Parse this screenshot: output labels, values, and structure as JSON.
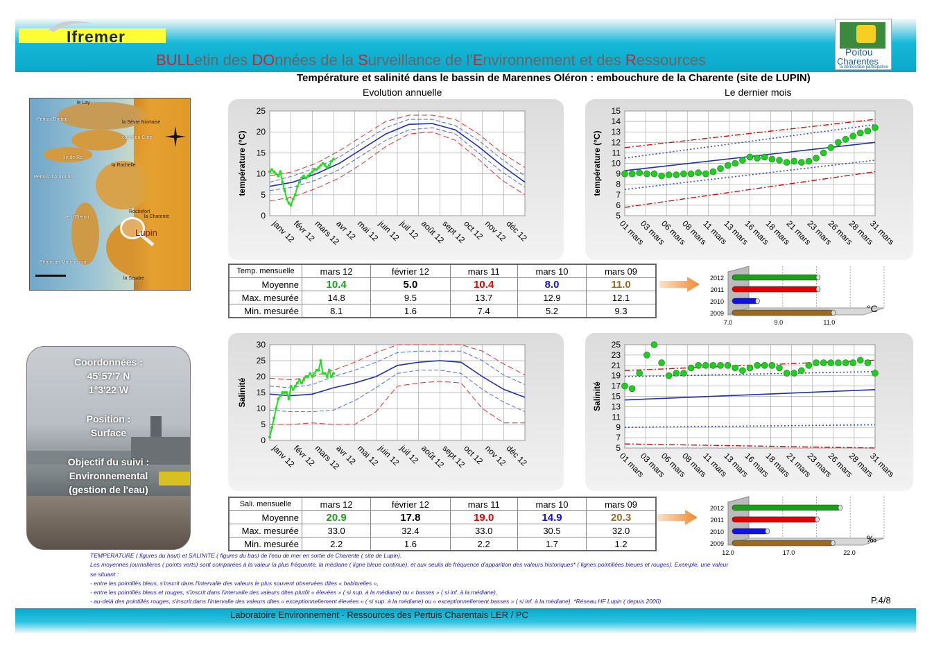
{
  "header": {
    "logo": "Ifremer",
    "bulletin_parts": [
      {
        "text": "BULL",
        "red": true
      },
      {
        "text": "etin des ",
        "red": false
      },
      {
        "text": "DO",
        "red": true
      },
      {
        "text": "nnées de la ",
        "red": false
      },
      {
        "text": "S",
        "red": true
      },
      {
        "text": "urveillance de l'",
        "red": false
      },
      {
        "text": "E",
        "red": true
      },
      {
        "text": "nvironnement et des ",
        "red": false
      },
      {
        "text": "R",
        "red": true
      },
      {
        "text": "essources",
        "red": false
      }
    ],
    "region_line1": "Poitou",
    "region_line2": "Charentes",
    "region_tag": "la démocratie participative",
    "region_vertical": "RÉGION"
  },
  "title": "Température et salinité dans le bassin de Marennes Oléron : embouchure de la Charente (site de LUPIN)",
  "subtitle_left": "Evolution annuelle",
  "subtitle_right": "Le dernier mois",
  "map": {
    "labels": [
      "le Lay",
      "Pertuis Breton",
      "la Sèvre Niortaise",
      "canal du Curé",
      "Ile de Ré",
      "la Rochelle",
      "Pertuis d'Antioche",
      "Rochefort",
      "la Charente",
      "Ile d'Oléron",
      "Lupin",
      "Peruis de Maumusson",
      "la Seudre"
    ]
  },
  "photo": {
    "coord_label": "Coordonnées :",
    "lat": "45°57'7 N",
    "lon": "1°3'22 W",
    "position_label": "Position :",
    "position_value": "Surface",
    "objectif_label": "Objectif du suivi :",
    "objectif_value": "Environnemental",
    "objectif_detail": "(gestion de l'eau)"
  },
  "colors": {
    "green": "#1aa01a",
    "red": "#e00000",
    "blue": "#1010e0",
    "brown": "#9a6a20",
    "navy": "#1f2fb0"
  },
  "chart_data": [
    {
      "type": "line",
      "ylabel": "température (°C)",
      "ylim": [
        0,
        25
      ],
      "yticks": [
        0,
        5,
        10,
        15,
        20,
        25
      ],
      "xticks": [
        "janv 12",
        "févr 12",
        "mars 12",
        "avr 12",
        "mai 12",
        "juin 12",
        "juil 12",
        "août 12",
        "sept 12",
        "oct 12",
        "nov 12",
        "déc 12"
      ],
      "x_months": [
        0,
        1,
        2,
        3,
        4,
        5,
        6,
        7,
        8,
        9,
        10,
        11,
        12
      ],
      "series": [
        {
          "style": "median",
          "values": [
            7,
            8,
            10,
            12.5,
            16,
            19.5,
            21.8,
            22,
            20.5,
            16.5,
            12,
            8
          ]
        },
        {
          "style": "blue_dash_high",
          "values": [
            8,
            9.5,
            11.5,
            14,
            17.5,
            21,
            23,
            23,
            21.5,
            18,
            13.5,
            9.5
          ]
        },
        {
          "style": "blue_dash_low",
          "values": [
            6,
            6.8,
            8.5,
            11,
            14.5,
            18,
            20.5,
            21,
            19.5,
            15,
            10.5,
            6.8
          ]
        },
        {
          "style": "red_dash_high",
          "values": [
            9.5,
            10.5,
            12.5,
            15.5,
            19,
            22.5,
            24,
            24,
            23,
            19.5,
            15,
            11.5
          ]
        },
        {
          "style": "red_dash_low",
          "values": [
            3.5,
            4.5,
            6.5,
            9,
            12.5,
            16.5,
            19.5,
            20,
            18,
            13.5,
            8.5,
            5
          ]
        },
        {
          "style": "green_obs",
          "x": [
            0,
            0.1,
            0.2,
            0.3,
            0.4,
            0.5,
            0.6,
            0.7,
            0.8,
            0.9,
            1.0,
            1.1,
            1.2,
            1.3,
            1.4,
            1.5,
            1.6,
            1.7,
            1.8,
            1.9,
            2.0,
            2.1,
            2.2,
            2.3,
            2.4,
            2.5,
            2.6,
            2.7,
            2.8,
            2.9,
            3.0
          ],
          "values": [
            10.5,
            11,
            10.5,
            10,
            9.5,
            10.5,
            8,
            6,
            4,
            3,
            2.5,
            4,
            5,
            7,
            8,
            9,
            9.5,
            9,
            9.5,
            10,
            10.5,
            11,
            11,
            11.5,
            12,
            12.5,
            12,
            11.5,
            12,
            13,
            13.5
          ]
        }
      ]
    },
    {
      "type": "scatter",
      "ylabel": "température (°C)",
      "ylim": [
        5,
        15
      ],
      "yticks": [
        5,
        6,
        7,
        8,
        9,
        10,
        11,
        12,
        13,
        14,
        15
      ],
      "xticks": [
        "01 mars",
        "03 mars",
        "06 mars",
        "08 mars",
        "11 mars",
        "13 mars",
        "16 mars",
        "18 mars",
        "21 mars",
        "23 mars",
        "26 mars",
        "28 mars",
        "31 mars"
      ],
      "days": 31,
      "lines": [
        {
          "style": "median",
          "from": 9.3,
          "to": 12
        },
        {
          "style": "blue_dot_high",
          "from": 10.5,
          "to": 13.7
        },
        {
          "style": "blue_dot_low",
          "from": 7.5,
          "to": 10.3
        },
        {
          "style": "red_dashdot_high",
          "from": 11.5,
          "to": 14.2
        },
        {
          "style": "red_dashdot_low",
          "from": 5.8,
          "to": 9.2
        }
      ],
      "points": [
        9,
        9,
        9.1,
        9,
        9,
        8.8,
        8.9,
        8.9,
        9,
        9,
        9.1,
        9,
        9.2,
        9.5,
        9.8,
        10,
        10.3,
        10.6,
        10.5,
        10.6,
        10.4,
        10.3,
        10.1,
        10.2,
        10.1,
        10.2,
        10.5,
        11,
        11.5,
        12,
        12.3,
        12.6,
        12.9,
        13.1,
        13.4
      ]
    },
    {
      "type": "line",
      "ylabel": "Salinité",
      "ylim": [
        0,
        30
      ],
      "yticks": [
        0,
        5,
        10,
        15,
        20,
        25,
        30
      ],
      "xticks": [
        "janv 12",
        "févr 12",
        "mars 12",
        "avr 12",
        "mai 12",
        "juin 12",
        "juil 12",
        "août 12",
        "sept 12",
        "oct 12",
        "nov 12",
        "déc 12"
      ],
      "series": [
        {
          "style": "median",
          "values": [
            14.5,
            14,
            14.5,
            16.5,
            18,
            20,
            23.5,
            24.5,
            25,
            24.5,
            20,
            16,
            13.5
          ]
        },
        {
          "style": "blue_dash_high",
          "values": [
            17,
            16.5,
            17.5,
            20,
            22,
            24.5,
            27.5,
            28,
            28,
            28,
            25,
            20.5,
            17.5
          ]
        },
        {
          "style": "blue_dash_low",
          "values": [
            9.5,
            9,
            9,
            9.5,
            12.5,
            16.5,
            21,
            22,
            22,
            21,
            16,
            12,
            9
          ]
        },
        {
          "style": "red_dash_high",
          "values": [
            19.5,
            19,
            20,
            22,
            24.5,
            27.5,
            30,
            30,
            30,
            30,
            28,
            24,
            20.5
          ]
        },
        {
          "style": "red_dash_low",
          "values": [
            5,
            5,
            5.5,
            5,
            5,
            9,
            17,
            18,
            18.5,
            18,
            10,
            5.5,
            5.5
          ]
        },
        {
          "style": "green_obs",
          "x": [
            0,
            0.1,
            0.2,
            0.3,
            0.4,
            0.5,
            0.6,
            0.7,
            0.8,
            0.9,
            1.0,
            1.1,
            1.2,
            1.3,
            1.4,
            1.5,
            1.6,
            1.7,
            1.8,
            1.9,
            2.0,
            2.1,
            2.2,
            2.3,
            2.4,
            2.5,
            2.6,
            2.7,
            2.8,
            2.9,
            3.0
          ],
          "values": [
            1,
            4,
            7,
            10,
            13,
            14,
            15,
            15,
            15,
            13,
            17,
            16,
            17,
            18,
            19,
            18,
            19,
            20,
            20,
            21,
            20,
            21,
            22,
            22,
            25,
            21,
            21,
            20,
            22,
            20,
            21
          ]
        }
      ]
    },
    {
      "type": "scatter",
      "ylabel": "Salinité",
      "ylim": [
        5,
        25
      ],
      "yticks": [
        5,
        7,
        9,
        11,
        13,
        15,
        17,
        19,
        21,
        23,
        25
      ],
      "xticks": [
        "01 mars",
        "03 mars",
        "06 mars",
        "08 mars",
        "11 mars",
        "13 mars",
        "16 mars",
        "18 mars",
        "21 mars",
        "23 mars",
        "26 mars",
        "28 mars",
        "31 mars"
      ],
      "days": 31,
      "lines": [
        {
          "style": "median",
          "from": 14.3,
          "to": 16.3
        },
        {
          "style": "blue_dot_high",
          "from": 18.8,
          "to": 19.8
        },
        {
          "style": "blue_dot_low",
          "from": 9,
          "to": 9.5
        },
        {
          "style": "red_dashdot_high",
          "from": 20,
          "to": 22
        },
        {
          "style": "red_dashdot_low",
          "from": 5.8,
          "to": 5
        }
      ],
      "points": [
        17,
        16.5,
        19.5,
        23,
        25,
        21.5,
        19,
        19.5,
        19.5,
        20.5,
        21,
        21,
        21,
        21,
        21,
        20.5,
        20,
        20.5,
        21,
        21,
        21,
        20.5,
        19.5,
        19.5,
        20,
        21,
        21.5,
        21.5,
        21.5,
        21.5,
        21.5,
        21.5,
        22,
        21.5,
        19.5
      ]
    },
    {
      "type": "bar",
      "categories": [
        "2012",
        "2011",
        "2010",
        "2009"
      ],
      "values": [
        10.4,
        10.4,
        8.0,
        11.0
      ],
      "xticks": [
        "7.0",
        "9.0",
        "11.0"
      ],
      "xlim": [
        7,
        11.8
      ],
      "unit": "°C"
    },
    {
      "type": "bar",
      "categories": [
        "2012",
        "2011",
        "2010",
        "2009"
      ],
      "values": [
        20.9,
        19.0,
        14.9,
        20.3
      ],
      "xticks": [
        "12.0",
        "17.0",
        "22.0"
      ],
      "xlim": [
        12,
        22
      ],
      "unit": "‰"
    }
  ],
  "table_temp": {
    "corner": "Temp. mensuelle",
    "headers": [
      "mars 12",
      "février 12",
      "mars 11",
      "mars 10",
      "mars 09"
    ],
    "rows": [
      {
        "label": "Moyenne",
        "values": [
          "10.4",
          "5.0",
          "10.4",
          "8.0",
          "11.0"
        ]
      },
      {
        "label": "Max. mesurée",
        "values": [
          "14.8",
          "9.5",
          "13.7",
          "12.9",
          "12.1"
        ]
      },
      {
        "label": "Min. mesurée",
        "values": [
          "8.1",
          "1.6",
          "7.4",
          "5.2",
          "9.3"
        ]
      }
    ]
  },
  "table_sal": {
    "corner": "Sali. mensuelle",
    "headers": [
      "mars 12",
      "février 12",
      "mars 11",
      "mars 10",
      "mars 09"
    ],
    "rows": [
      {
        "label": "Moyenne",
        "values": [
          "20.9",
          "17.8",
          "19.0",
          "14.9",
          "20.3"
        ]
      },
      {
        "label": "Max. mesurée",
        "values": [
          "33.0",
          "32.4",
          "33.0",
          "30.5",
          "32.0"
        ]
      },
      {
        "label": "Min. mesurée",
        "values": [
          "2.2",
          "1.6",
          "2.2",
          "1.7",
          "1.2"
        ]
      }
    ]
  },
  "notes": [
    "TEMPERATURE ( figures du haut) et SALINITE ( figures du bas) de l'eau de mer en sortie de Charente ( site de Lupin).",
    "Les moyennes journalières ( points verts) sont comparées à la valeur la plus fréquente, la médiane ( ligne bleue continue), et aux seuils de fréquence d'apparition des valeurs historiques* ( lignes pointillées bleues et rouges). Exemple, une valeur",
    "se situant :",
    "- entre les pointillés bleus,  s'inscrit dans l'intervalle des valeurs le plus souvent observées dites « habituelles »,",
    "- entre les pointillés bleus et rouges,  s'inscrit dans l'intervalle des valeurs dites plutôt « élevées » ( si sup. à la médiane) ou « basses » ( si inf. à la médiane),",
    "- au-delà des pointillés rouges,  s'inscrit dans l'intervalle des valeurs dites « exceptionnellement élevées » ( si sup. à la médiane) ou « exceptionnellement basses » ( si inf. à la médiane).  *Réseau HF Lupin ( depuis 2000)"
  ],
  "page": "P.4/8",
  "footer": "Laboratoire Environnement - Ressources des Pertuis Charentais      LER / PC"
}
